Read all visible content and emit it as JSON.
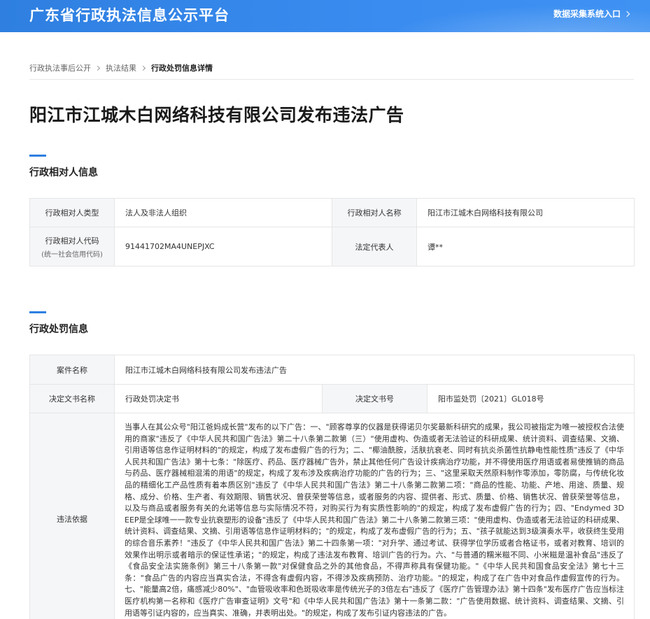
{
  "header": {
    "site_title": "广东省行政执法信息公示平台",
    "portal_link": "数据采集系统入口"
  },
  "breadcrumb": {
    "items": [
      "行政执法事后公开",
      "执法结果",
      "行政处罚信息详情"
    ]
  },
  "page": {
    "title": "阳江市江城木白网络科技有限公司发布违法广告"
  },
  "party_section": {
    "title": "行政相对人信息",
    "type_label": "行政相对人类型",
    "type_value": "法人及非法人组织",
    "name_label": "行政相对人名称",
    "name_value": "阳江市江城木白网络科技有限公司",
    "code_label": "行政相对人代码",
    "code_sublabel": "(统一社会信用代码)",
    "code_value": "91441702MA4UNEPJXC",
    "rep_label": "法定代表人",
    "rep_value": "谭**"
  },
  "penalty_section": {
    "title": "行政处罚信息",
    "case_name_label": "案件名称",
    "case_name_value": "阳江市江城木白网络科技有限公司发布违法广告",
    "doc_name_label": "决定文书名称",
    "doc_name_value": "行政处罚决定书",
    "doc_no_label": "决定文书号",
    "doc_no_value": "阳市监处罚〔2021〕GL018号",
    "basis_label": "违法依据",
    "basis_text": "当事人在其公众号\"阳江爸妈成长营\"发布的以下广告：一、\"顾客尊享的仪器是获得诺贝尔奖最新科研究的成果，我公司被指定为唯一被授权合法使用的商家\"违反了《中华人民共和国广告法》第二十八条第二款第（三）\"使用虚构、伪造或者无法验证的科研成果、统计资料、调查结果、文摘、引用语等信息作证明材料的\"的规定，构成了发布虚假广告的行为；二、\"椰油酰胺，活肤抗衰老、同时有抗炎杀菌性抗静电性能性质\"违反了《中华人民共和国广告法》第十七条：\"除医疗、药品、医疗器械广告外，禁止其他任何广告设计疾病治疗功能，并不得使用医疗用语或者易使推销的商品与药品、医疗器械相混淆的用语\"的规定，构成了发布涉及疾病治疗功能的广告的行为；三、\"这里采取天然原料制作零添加，零防腐，与传统化妆品的精细化工产品性质有着本质区别\"违反了《中华人民共和国广告法》第二十八条第二款第二项：\"商品的性能、功能、产地、用途、质量、规格、成分、价格、生产者、有效期限、销售状况、曾获荣誉等信息，或者服务的内容、提供者、形式、质量、价格、销售状况、曾获荣誉等信息，以及与商品或者服务有关的允诺等信息与实际情况不符，对购买行为有实质性影响的\"的规定，构成了发布虚假广告的行为；四、\"Endymed 3D EEP是全球唯一一款专业抗衰塑形的设备\"违反了《中华人民共和国广告法》第二十八条第二款第三项：\"使用虚构、伪造或者无法验证的科研成果、统计资料、调查结果、文摘、引用语等信息作证明材料的；\"的规定，构成了发布虚假广告的行为；五、\"孩子就能达到3级演奏水平，收获终生受用的综合音乐素养！\"违反了《中华人民共和国广告法》第二十四条第一项：\"对升学、通过考试、获得学位学历或者合格证书，或者对教育、培训的效果作出明示或者暗示的保证性承诺；\"的规定，构成了违法发布教育、培训广告的行为。六、\"与普通的糯米糍不同、小米糍是温补食品\"违反了《食品安全法实施条例》第三十八条第一款\"对保健食品之外的其他食品，不得声称具有保健功能。\"《中华人民共和国食品安全法》第七十三条：\"食品广告的内容应当真实合法，不得含有虚假内容，不得涉及疾病预防、治疗功能。\"的规定，构成了在广告中对食品作虚假宣传的行为。七、\"能量高2倍，痛感减少80%\"、\"血管吸收率和色斑吸收率是传统光子的3倍左右\"违反了《医疗广告管理办法》第十四条\"发布医疗广告应当标注医疗机构第一名称和《医疗广告审查证明》文号\"和《中华人民共和国广告法》第十一条第二款：\"广告使用数据、统计资料、调查结果、文摘、引用语等引证内容的，应当真实、准确，并表明出处。\"的规定，构成了发布引证内容违法的广告。"
  },
  "colors": {
    "header_blue": "#2e7fe0",
    "label_bg": "#f5f6f8",
    "border": "#e6e6e6"
  }
}
